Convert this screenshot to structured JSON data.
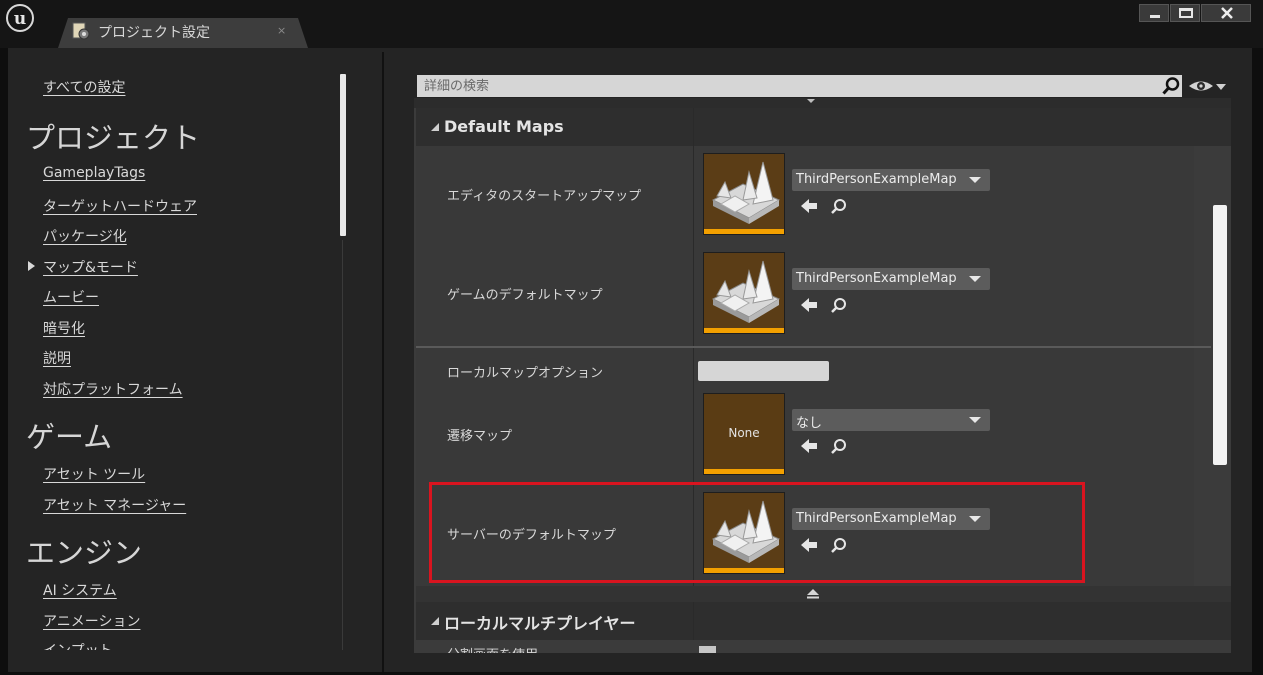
{
  "window": {
    "logo_glyph": "u",
    "tab_label": "プロジェクト設定",
    "tab_close": "×",
    "buttons": [
      "minimize-button",
      "maximize-button",
      "close-button"
    ]
  },
  "sidebar": {
    "all_settings": "すべての設定",
    "sections": [
      {
        "title": "プロジェクト",
        "items": [
          "GameplayTags",
          "ターゲットハードウェア",
          "パッケージ化",
          "マップ&モード",
          "ムービー",
          "暗号化",
          "説明",
          "対応プラットフォーム"
        ]
      },
      {
        "title": "ゲーム",
        "items": [
          "アセット ツール",
          "アセット マネージャー"
        ]
      },
      {
        "title": "エンジン",
        "items": [
          "AI システム",
          "アニメーション",
          "インプット"
        ]
      }
    ]
  },
  "search": {
    "placeholder": "詳細の検索"
  },
  "details": {
    "category_default_maps": "Default Maps",
    "editor_startup_map": {
      "label": "エディタのスタートアップマップ",
      "value": "ThirdPersonExampleMap"
    },
    "game_default_map": {
      "label": "ゲームのデフォルトマップ",
      "value": "ThirdPersonExampleMap"
    },
    "local_map_options": {
      "label": "ローカルマップオプション",
      "value": ""
    },
    "transition_map": {
      "label": "遷移マップ",
      "thumb_text": "None",
      "value": "なし"
    },
    "server_default_map": {
      "label": "サーバーのデフォルトマップ",
      "value": "ThirdPersonExampleMap"
    },
    "category_local_multiplayer": "ローカルマルチプレイヤー",
    "use_splitscreen": {
      "label": "分割画面を使用"
    }
  },
  "colors": {
    "accent_orange": "#f3a000",
    "highlight_red": "#d9141f",
    "thumb_brown": "#5b3d16"
  }
}
